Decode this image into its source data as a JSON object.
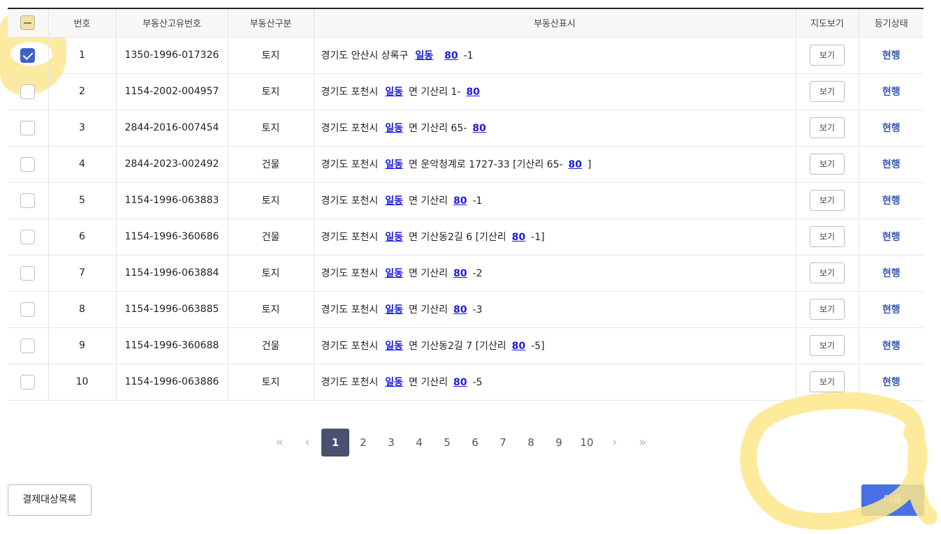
{
  "table": {
    "headers": {
      "no": "번호",
      "unique_id": "부동산고유번호",
      "category": "부동산구분",
      "address": "부동산표시",
      "map": "지도보기",
      "status": "등기상태"
    },
    "rows": [
      {
        "no": "1",
        "id": "1350-1996-017326",
        "category": "토지",
        "addr_a": "경기도 안산시 상록구",
        "link1": "일동",
        "addr_b": "",
        "link2": "80",
        "addr_c": "-1",
        "map": "보기",
        "status": "현행",
        "checked": true
      },
      {
        "no": "2",
        "id": "1154-2002-004957",
        "category": "토지",
        "addr_a": "경기도 포천시",
        "link1": "일동",
        "addr_b": "면 기산리 1-",
        "link2": "80",
        "addr_c": "",
        "map": "보기",
        "status": "현행",
        "checked": false
      },
      {
        "no": "3",
        "id": "2844-2016-007454",
        "category": "토지",
        "addr_a": "경기도 포천시",
        "link1": "일동",
        "addr_b": "면 기산리 65-",
        "link2": "80",
        "addr_c": "",
        "map": "보기",
        "status": "현행",
        "checked": false
      },
      {
        "no": "4",
        "id": "2844-2023-002492",
        "category": "건물",
        "addr_a": "경기도 포천시",
        "link1": "일동",
        "addr_b": "면 운악청계로 1727-33 [기산리 65-",
        "link2": "80",
        "addr_c": "]",
        "map": "보기",
        "status": "현행",
        "checked": false
      },
      {
        "no": "5",
        "id": "1154-1996-063883",
        "category": "토지",
        "addr_a": "경기도 포천시",
        "link1": "일동",
        "addr_b": "면 기산리",
        "link2": "80",
        "addr_c": "-1",
        "map": "보기",
        "status": "현행",
        "checked": false
      },
      {
        "no": "6",
        "id": "1154-1996-360686",
        "category": "건물",
        "addr_a": "경기도 포천시",
        "link1": "일동",
        "addr_b": "면 기산동2길 6 [기산리",
        "link2": "80",
        "addr_c": "-1]",
        "map": "보기",
        "status": "현행",
        "checked": false
      },
      {
        "no": "7",
        "id": "1154-1996-063884",
        "category": "토지",
        "addr_a": "경기도 포천시",
        "link1": "일동",
        "addr_b": "면 기산리",
        "link2": "80",
        "addr_c": "-2",
        "map": "보기",
        "status": "현행",
        "checked": false
      },
      {
        "no": "8",
        "id": "1154-1996-063885",
        "category": "토지",
        "addr_a": "경기도 포천시",
        "link1": "일동",
        "addr_b": "면 기산리",
        "link2": "80",
        "addr_c": "-3",
        "map": "보기",
        "status": "현행",
        "checked": false
      },
      {
        "no": "9",
        "id": "1154-1996-360688",
        "category": "건물",
        "addr_a": "경기도 포천시",
        "link1": "일동",
        "addr_b": "면 기산동2길 7 [기산리",
        "link2": "80",
        "addr_c": "-5]",
        "map": "보기",
        "status": "현행",
        "checked": false
      },
      {
        "no": "10",
        "id": "1154-1996-063886",
        "category": "토지",
        "addr_a": "경기도 포천시",
        "link1": "일동",
        "addr_b": "면 기산리",
        "link2": "80",
        "addr_c": "-5",
        "map": "보기",
        "status": "현행",
        "checked": false
      }
    ]
  },
  "pagination": {
    "first": "«",
    "prev": "‹",
    "pages": [
      "1",
      "2",
      "3",
      "4",
      "5",
      "6",
      "7",
      "8",
      "9",
      "10"
    ],
    "active": "1",
    "next": "›",
    "last": "»"
  },
  "buttons": {
    "payment_list": "결제대상목록",
    "next": "다음"
  },
  "icons": {
    "header_checkbox": "partial-check-icon",
    "row_checkbox": "checkbox-icon"
  },
  "colors": {
    "accent": "#4060c9",
    "link": "#1a1ae6",
    "status": "#3657b8",
    "next_button": "#4970e8",
    "active_page": "#4a5070",
    "highlight": "#fde68a"
  }
}
